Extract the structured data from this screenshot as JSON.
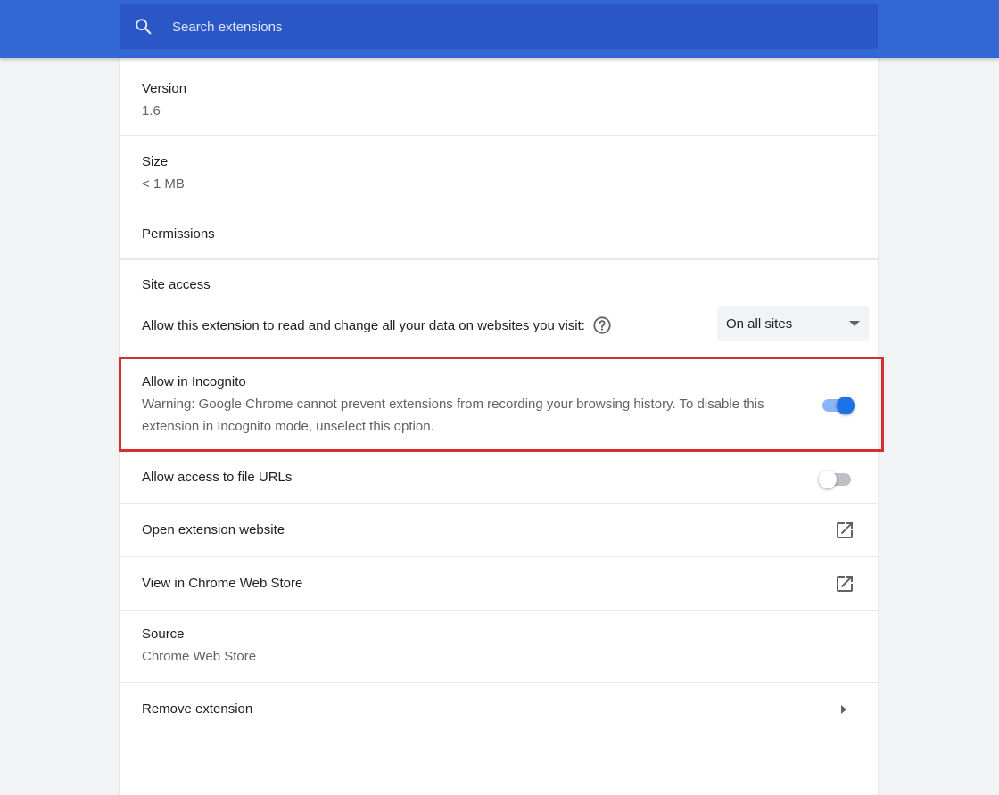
{
  "search": {
    "placeholder": "Search extensions"
  },
  "details": {
    "version": {
      "label": "Version",
      "value": "1.6"
    },
    "size": {
      "label": "Size",
      "value": "< 1 MB"
    },
    "permissions": {
      "label": "Permissions"
    },
    "site_access": {
      "label": "Site access",
      "description": "Allow this extension to read and change all your data on websites you visit:",
      "help_icon": "help-circle-icon",
      "selected_option": "On all sites"
    },
    "incognito": {
      "label": "Allow in Incognito",
      "warning": "Warning: Google Chrome cannot prevent extensions from recording your browsing history. To disable this extension in Incognito mode, unselect this option.",
      "enabled": true
    },
    "file_urls": {
      "label": "Allow access to file URLs",
      "enabled": false
    },
    "open_website": {
      "label": "Open extension website",
      "icon": "open-in-new-icon"
    },
    "web_store": {
      "label": "View in Chrome Web Store",
      "icon": "open-in-new-icon"
    },
    "source": {
      "label": "Source",
      "value": "Chrome Web Store"
    },
    "remove": {
      "label": "Remove extension",
      "icon": "arrow-right-icon"
    }
  },
  "colors": {
    "header": "#3367d6",
    "search_bg": "#2a56c6",
    "toggle_on_knob": "#1a73e8",
    "toggle_on_track": "#8ab4f8",
    "toggle_off_knob": "#ffffff",
    "toggle_off_track": "#bdc1c6",
    "highlight_border": "#d32f2f"
  }
}
